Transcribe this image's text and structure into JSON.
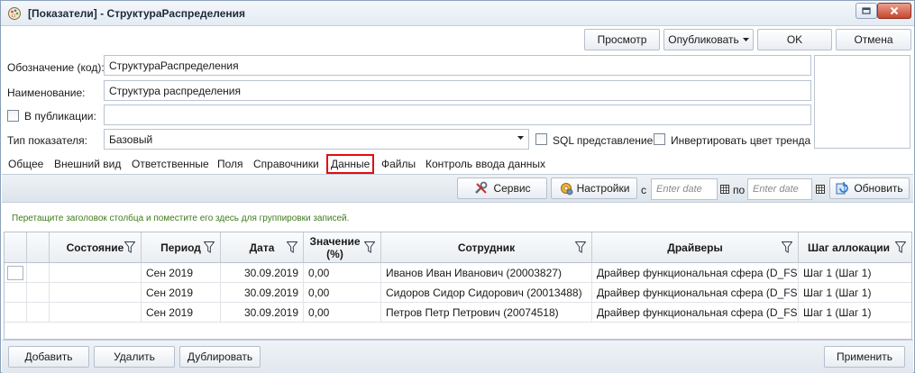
{
  "window": {
    "title": "[Показатели] - СтруктураРаспределения"
  },
  "toolbar": {
    "preview": "Просмотр",
    "publish": "Опубликовать",
    "ok": "OK",
    "cancel": "Отмена"
  },
  "form": {
    "code_label": "Обозначение (код):",
    "code_value": "СтруктураРаспределения",
    "name_label": "Наименование:",
    "name_value": "Структура распределения",
    "publish_label": "В публикации:",
    "publish_value": "",
    "type_label": "Тип показателя:",
    "type_value": "Базовый",
    "sql_label": "SQL представление",
    "invert_label": "Инвертировать цвет тренда"
  },
  "tabs": [
    "Общее",
    "Внешний вид",
    "Ответственные",
    "Поля",
    "Справочники",
    "Данные",
    "Файлы",
    "Контроль ввода данных"
  ],
  "data_toolbar": {
    "service": "Сервис",
    "settings": "Настройки",
    "from_label": "с",
    "from_placeholder": "Enter date",
    "to_label": "по",
    "to_placeholder": "Enter date",
    "refresh": "Обновить"
  },
  "group_hint": "Перетащите заголовок столбца и поместите его здесь для группировки записей.",
  "grid": {
    "columns": [
      "Состояние",
      "Период",
      "Дата",
      "Значение (%)",
      "Сотрудник",
      "Драйверы",
      "Шаг аллокации"
    ],
    "rows": [
      [
        "",
        "Сен 2019",
        "30.09.2019",
        "0,00",
        "Иванов Иван Иванович (20003827)",
        "Драйвер функциональная сфера (D_FS)",
        "Шаг 1 (Шаг 1)"
      ],
      [
        "",
        "Сен 2019",
        "30.09.2019",
        "0,00",
        "Сидоров Сидор Сидорович (20013488)",
        "Драйвер функциональная сфера (D_FS)",
        "Шаг 1 (Шаг 1)"
      ],
      [
        "",
        "Сен 2019",
        "30.09.2019",
        "0,00",
        "Петров Петр Петрович (20074518)",
        "Драйвер функциональная сфера (D_FS)",
        "Шаг 1 (Шаг 1)"
      ]
    ]
  },
  "bottom": {
    "add": "Добавить",
    "delete": "Удалить",
    "duplicate": "Дублировать",
    "apply": "Применить"
  },
  "colors": {
    "accent_tab_border": "#e30d0d",
    "group_hint": "#3d7c1a"
  }
}
